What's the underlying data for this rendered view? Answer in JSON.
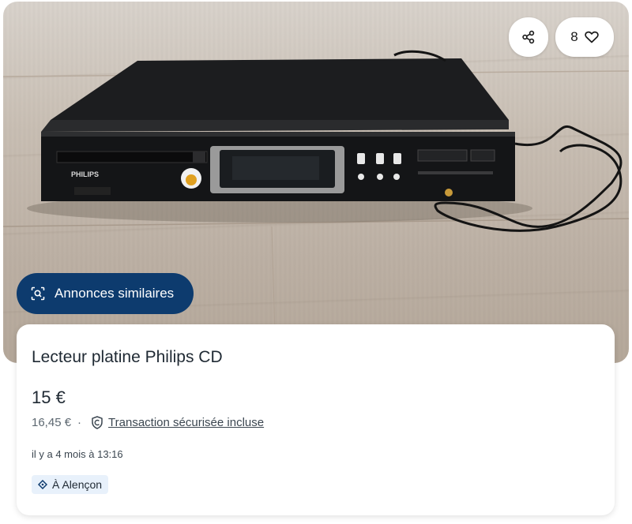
{
  "listing": {
    "title": "Lecteur platine Philips CD",
    "price": "15 €",
    "price_with_fee": "16,45 €",
    "separator": "·",
    "secure_transaction_label": "Transaction sécurisée incluse",
    "posted_time": "il y a 4 mois à 13:16",
    "location": "À Alençon"
  },
  "photo": {
    "brand_text": "PHILIPS",
    "alt_subject": "cd-player-photo"
  },
  "actions": {
    "favorite_count": "8",
    "similar_ads_label": "Annonces similaires"
  },
  "icons": {
    "share": "share-icon",
    "favorite": "heart-icon",
    "similar": "image-search-icon",
    "secure": "shield-icon",
    "location": "location-diamond-icon"
  },
  "colors": {
    "primary_dark_blue": "#0d3b6e",
    "location_badge_bg": "#e8f1fb",
    "text": "#1f2933"
  }
}
